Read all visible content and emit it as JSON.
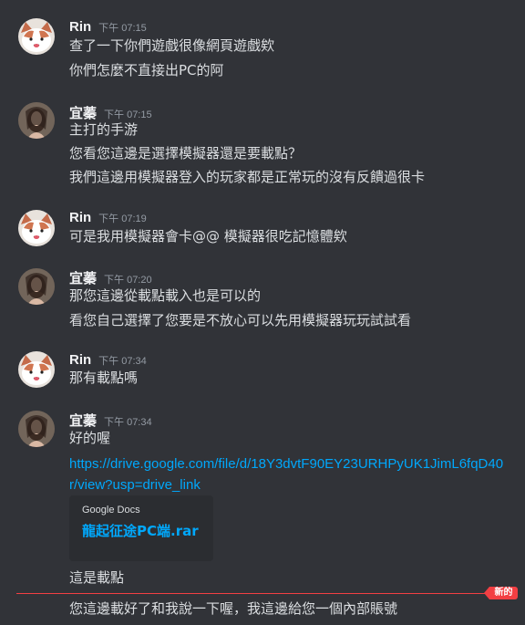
{
  "colors": {
    "background": "#313338",
    "username": "#f2f3f5",
    "timestamp": "#949ba4",
    "text": "#dbdee1",
    "link": "#00a8fc",
    "embed_bg": "#2b2d31",
    "new_divider": "#f23f43"
  },
  "messages": [
    {
      "author": "Rin",
      "time": "下午 07:15",
      "avatar": "cat-avatar",
      "lines": [
        "查了一下你們遊戲很像網頁遊戲欸",
        "你們怎麼不直接出PC的阿"
      ]
    },
    {
      "author": "宜蓁",
      "time": "下午 07:15",
      "avatar": "photo-avatar",
      "lines": [
        "主打的手游",
        "您看您這邊是選擇模擬器還是要載點？",
        "我們這邊用模擬器登入的玩家都是正常玩的沒有反饋過很卡"
      ]
    },
    {
      "author": "Rin",
      "time": "下午 07:19",
      "avatar": "cat-avatar",
      "lines": [
        "可是我用模擬器會卡@@ 模擬器很吃記憶體欸"
      ]
    },
    {
      "author": "宜蓁",
      "time": "下午 07:20",
      "avatar": "photo-avatar",
      "lines": [
        "那您這邊從載點載入也是可以的",
        "看您自己選擇了您要是不放心可以先用模擬器玩玩試試看"
      ]
    },
    {
      "author": "Rin",
      "time": "下午 07:34",
      "avatar": "cat-avatar",
      "lines": [
        "那有載點嗎"
      ]
    },
    {
      "author": "宜蓁",
      "time": "下午 07:34",
      "avatar": "photo-avatar",
      "lines": [
        "好的喔"
      ],
      "link": "https://drive.google.com/file/d/18Y3dvtF90EY23URHPyUK1JimL6fqD40r/view?usp=drive_link",
      "embed": {
        "provider": "Google Docs",
        "title": "龍起征途PC端.rar"
      },
      "after_embed": "這是載點",
      "after_divider": "您這邊載好了和我說一下喔，我這邊給您一個內部賬號"
    }
  ],
  "new_badge": "新的"
}
